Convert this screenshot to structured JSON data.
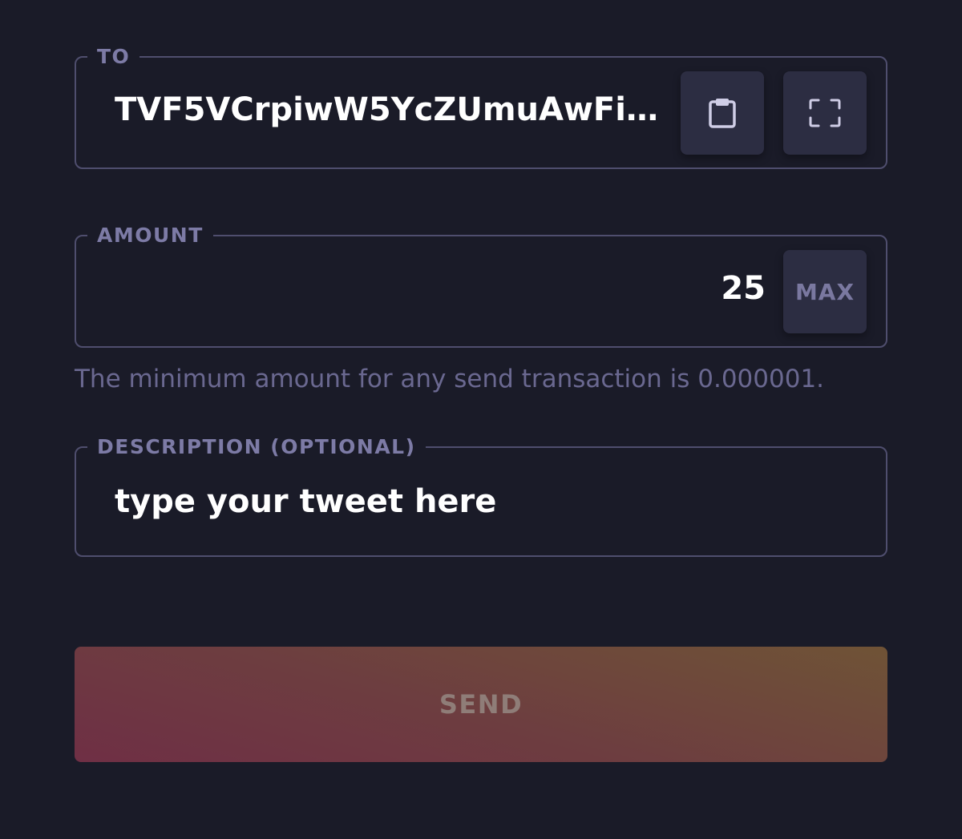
{
  "to": {
    "legend": "TO",
    "value": "TVF5VCrpiwW5YcZUmuAwFi…",
    "paste_icon": "clipboard-icon",
    "scan_icon": "scan-frame-icon"
  },
  "amount": {
    "legend": "AMOUNT",
    "value": "25",
    "max_label": "MAX",
    "note": "The minimum amount for any send transaction is 0.000001."
  },
  "description": {
    "legend": "DESCRIPTION (OPTIONAL)",
    "value": "type your tweet here"
  },
  "send": {
    "label": "SEND",
    "enabled": false
  },
  "colors": {
    "background": "#1a1b28",
    "border": "#4f4e6e",
    "label": "#7d7ba6",
    "button_bg": "#2c2d42",
    "send_gradient_start": "#6f2f45",
    "send_gradient_end": "#6f5336"
  }
}
